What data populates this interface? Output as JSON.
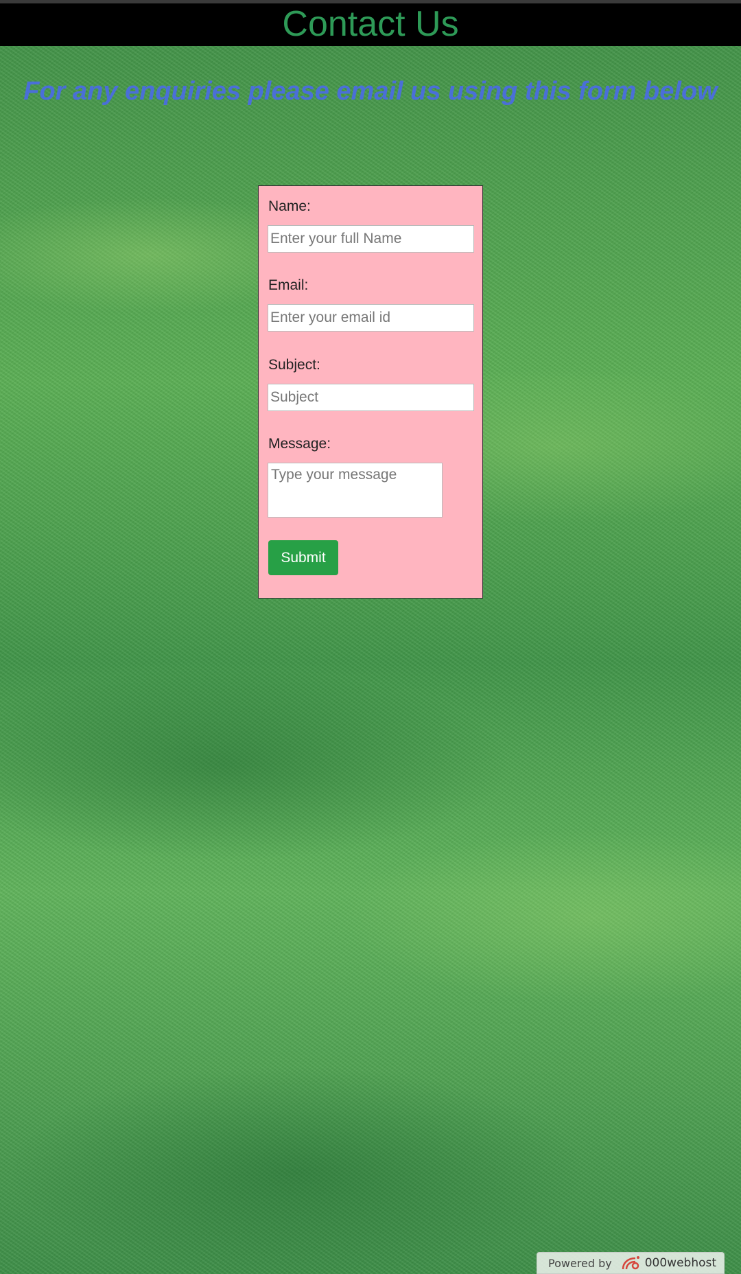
{
  "header": {
    "title": "Contact Us"
  },
  "tagline": "For any enquiries please email us using this form below",
  "form": {
    "name_label": "Name:",
    "name_placeholder": "Enter your full Name",
    "email_label": "Email:",
    "email_placeholder": "Enter your email id",
    "subject_label": "Subject:",
    "subject_placeholder": "Subject",
    "message_label": "Message:",
    "message_placeholder": "Type your message",
    "submit_label": "Submit"
  },
  "footer_badge": {
    "prefix": "Powered by",
    "brand": "000webhost",
    "logo_icon": "000webhost-logo-icon"
  },
  "colors": {
    "header_bg": "#000000",
    "header_title": "#2e9a57",
    "tagline": "#4a6fd8",
    "form_bg": "#ffb5c0",
    "submit_bg": "#27a046"
  }
}
